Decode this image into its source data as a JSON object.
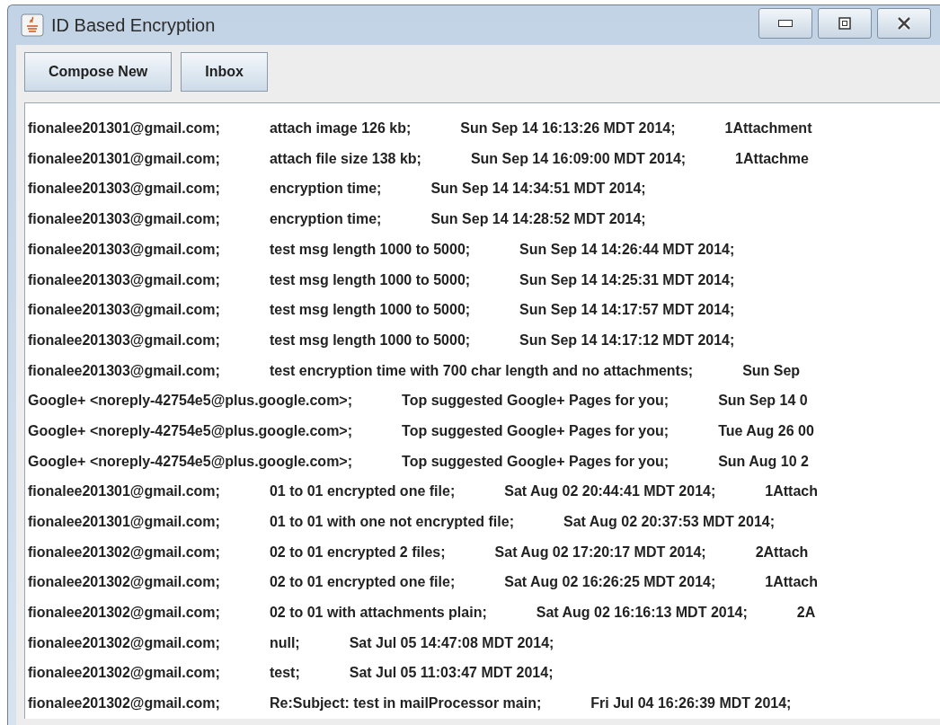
{
  "window": {
    "title": "ID Based Encryption"
  },
  "toolbar": {
    "buttons": [
      "Compose New",
      "Inbox"
    ]
  },
  "messages": [
    {
      "fields": [
        "fionalee201301@gmail.com;",
        "attach image 126 kb;",
        "Sun Sep 14 16:13:26 MDT 2014;",
        "1Attachment"
      ]
    },
    {
      "fields": [
        "fionalee201301@gmail.com;",
        "attach file size 138 kb;",
        "Sun Sep 14 16:09:00 MDT 2014;",
        "1Attachme"
      ]
    },
    {
      "fields": [
        "fionalee201303@gmail.com;",
        "encryption time;",
        "Sun Sep 14 14:34:51 MDT 2014;"
      ]
    },
    {
      "fields": [
        "fionalee201303@gmail.com;",
        "encryption time;",
        "Sun Sep 14 14:28:52 MDT 2014;"
      ]
    },
    {
      "fields": [
        "fionalee201303@gmail.com;",
        "test msg length 1000 to 5000;",
        "Sun Sep 14 14:26:44 MDT 2014;"
      ]
    },
    {
      "fields": [
        "fionalee201303@gmail.com;",
        "test msg length 1000 to 5000;",
        "Sun Sep 14 14:25:31 MDT 2014;"
      ]
    },
    {
      "fields": [
        "fionalee201303@gmail.com;",
        "test msg length 1000 to 5000;",
        "Sun Sep 14 14:17:57 MDT 2014;"
      ]
    },
    {
      "fields": [
        "fionalee201303@gmail.com;",
        "test msg length 1000 to 5000;",
        "Sun Sep 14 14:17:12 MDT 2014;"
      ]
    },
    {
      "fields": [
        "fionalee201303@gmail.com;",
        "test encryption time with 700 char length and no attachments;",
        "Sun Sep"
      ]
    },
    {
      "fields": [
        "Google+ <noreply-42754e5@plus.google.com>;",
        "Top suggested Google+ Pages for you;",
        "Sun Sep 14 0"
      ]
    },
    {
      "fields": [
        "Google+ <noreply-42754e5@plus.google.com>;",
        "Top suggested Google+ Pages for you;",
        "Tue Aug 26 00"
      ]
    },
    {
      "fields": [
        "Google+ <noreply-42754e5@plus.google.com>;",
        "Top suggested Google+ Pages for you;",
        "Sun Aug 10 2"
      ]
    },
    {
      "fields": [
        "fionalee201301@gmail.com;",
        "01 to 01 encrypted one file;",
        "Sat Aug 02 20:44:41 MDT 2014;",
        "1Attach"
      ]
    },
    {
      "fields": [
        "fionalee201301@gmail.com;",
        "01 to 01 with one not encrypted file;",
        "Sat Aug 02 20:37:53 MDT 2014;"
      ]
    },
    {
      "fields": [
        "fionalee201302@gmail.com;",
        "02 to 01 encrypted 2 files;",
        "Sat Aug 02 17:20:17 MDT 2014;",
        "2Attach"
      ]
    },
    {
      "fields": [
        "fionalee201302@gmail.com;",
        "02 to 01 encrypted one file;",
        "Sat Aug 02 16:26:25 MDT 2014;",
        "1Attach"
      ]
    },
    {
      "fields": [
        "fionalee201302@gmail.com;",
        "02 to 01 with attachments plain;",
        "Sat Aug 02 16:16:13 MDT 2014;",
        "2A"
      ]
    },
    {
      "fields": [
        "fionalee201302@gmail.com;",
        "null;",
        "Sat Jul 05 14:47:08 MDT 2014;"
      ]
    },
    {
      "fields": [
        "fionalee201302@gmail.com;",
        "test;",
        "Sat Jul 05 11:03:47 MDT 2014;"
      ]
    },
    {
      "fields": [
        "fionalee201302@gmail.com;",
        "Re:Subject: test in mailProcessor main;",
        "Fri Jul 04 16:26:39 MDT 2014;"
      ]
    }
  ]
}
